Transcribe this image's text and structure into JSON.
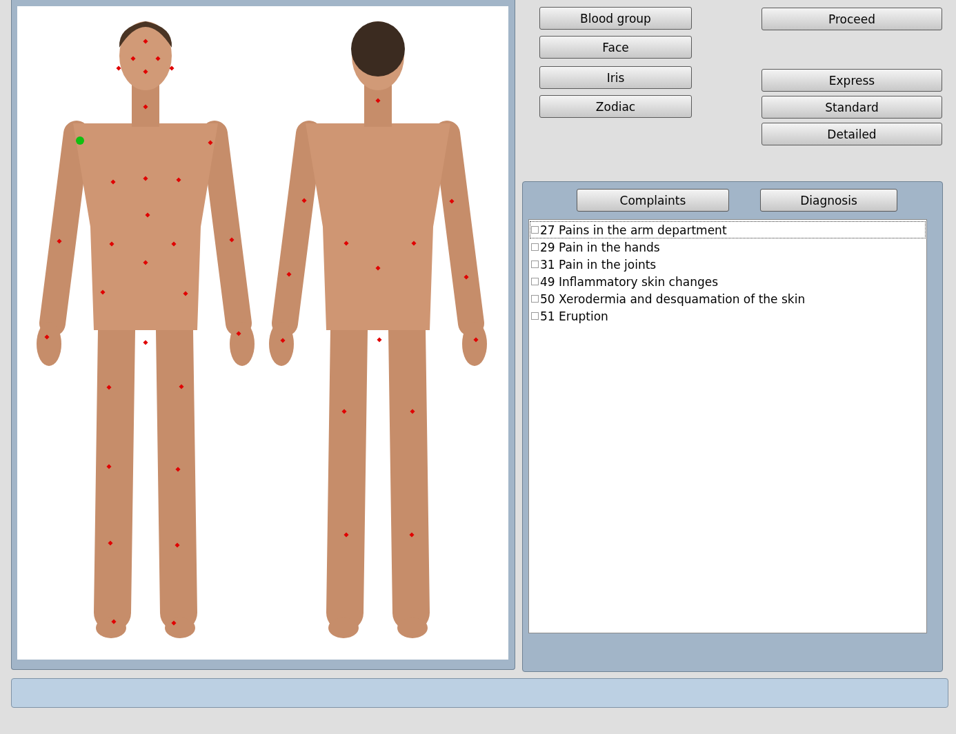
{
  "view_buttons": [
    "Blood group",
    "Face",
    "Iris",
    "Zodiac"
  ],
  "proceed_button": "Proceed",
  "mode_buttons": [
    "Express",
    "Standard",
    "Detailed"
  ],
  "panel_buttons": [
    "Complaints",
    "Diagnosis"
  ],
  "complaints": [
    {
      "label": "27 Pains in the arm department",
      "checked": false,
      "selected": true
    },
    {
      "label": "29 Pain in the hands",
      "checked": false,
      "selected": false
    },
    {
      "label": "31 Pain in the joints",
      "checked": false,
      "selected": false
    },
    {
      "label": "49 Inflammatory skin changes",
      "checked": false,
      "selected": false
    },
    {
      "label": "50 Xerodermia and desquamation of the skin",
      "checked": false,
      "selected": false
    },
    {
      "label": "51 Eruption",
      "checked": false,
      "selected": false
    }
  ]
}
